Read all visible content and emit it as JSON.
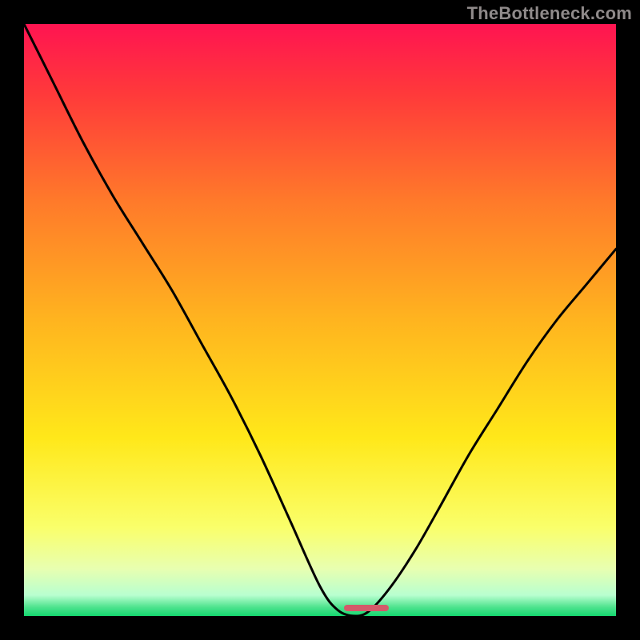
{
  "attribution": "TheBottleneck.com",
  "gradient": {
    "stops": [
      {
        "offset": 0,
        "color": "#ff1451"
      },
      {
        "offset": 0.12,
        "color": "#ff3a3a"
      },
      {
        "offset": 0.3,
        "color": "#ff7a2a"
      },
      {
        "offset": 0.5,
        "color": "#ffb41f"
      },
      {
        "offset": 0.7,
        "color": "#ffe81a"
      },
      {
        "offset": 0.85,
        "color": "#faff6a"
      },
      {
        "offset": 0.92,
        "color": "#e8ffb0"
      },
      {
        "offset": 0.965,
        "color": "#b8ffd0"
      },
      {
        "offset": 0.985,
        "color": "#4ee38e"
      },
      {
        "offset": 1.0,
        "color": "#15d86f"
      }
    ]
  },
  "pill": {
    "x_frac": 0.541,
    "y_frac": 0.986,
    "width_frac": 0.075,
    "color": "#d35a6a"
  },
  "chart_data": {
    "type": "line",
    "title": "",
    "xlabel": "",
    "ylabel": "",
    "xlim": [
      0,
      1
    ],
    "ylim": [
      0,
      100
    ],
    "series": [
      {
        "name": "bottleneck_curve",
        "x": [
          0.0,
          0.05,
          0.1,
          0.15,
          0.2,
          0.25,
          0.3,
          0.35,
          0.4,
          0.45,
          0.5,
          0.53,
          0.56,
          0.585,
          0.62,
          0.66,
          0.7,
          0.75,
          0.8,
          0.85,
          0.9,
          0.95,
          1.0
        ],
        "values": [
          100,
          90,
          80,
          71,
          63,
          55,
          46,
          37,
          27,
          16,
          5,
          1,
          0,
          1,
          5,
          11,
          18,
          27,
          35,
          43,
          50,
          56,
          62
        ]
      }
    ],
    "annotations": [
      {
        "type": "pill",
        "x_center": 0.575,
        "y": 0,
        "color": "#d35a6a"
      }
    ]
  }
}
